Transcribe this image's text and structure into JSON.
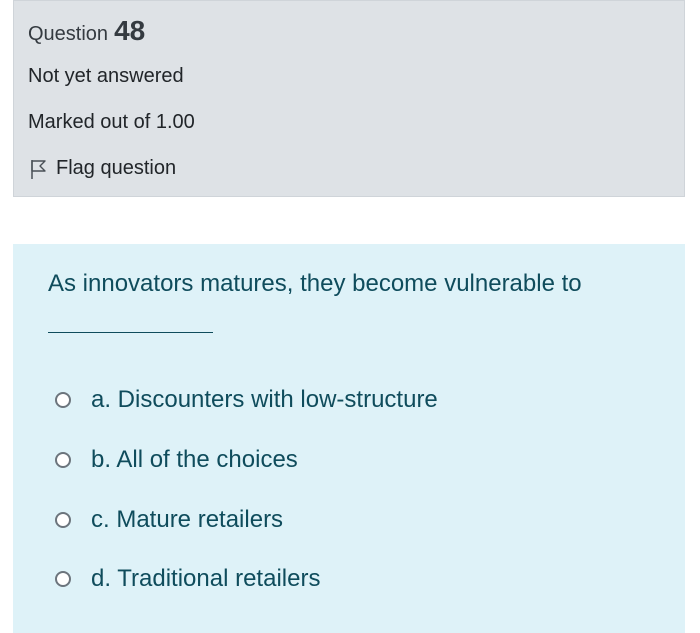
{
  "info": {
    "question_label": "Question",
    "question_number": "48",
    "state": "Not yet answered",
    "grade": "Marked out of 1.00",
    "flag_label": "Flag question"
  },
  "question": {
    "text": "As innovators matures, they become vulnerable to",
    "options": [
      {
        "label": "a. Discounters with low-structure",
        "selected": false
      },
      {
        "label": "b. All of the choices",
        "selected": false
      },
      {
        "label": "c. Mature retailers",
        "selected": false
      },
      {
        "label": "d. Traditional retailers",
        "selected": false
      }
    ]
  },
  "colors": {
    "info_background": "#dee2e6",
    "question_background": "#def2f8",
    "question_text": "#0f4c5c"
  },
  "icons": {
    "flag": "flag-icon",
    "radio": "radio-unchecked-icon"
  }
}
